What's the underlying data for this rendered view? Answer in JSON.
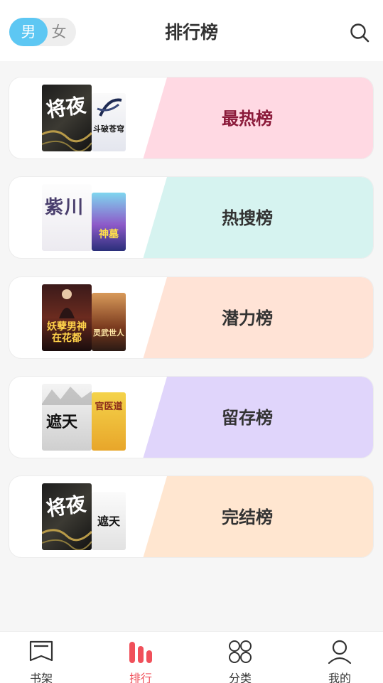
{
  "header": {
    "title": "排行榜",
    "gender_male": "男",
    "gender_female": "女",
    "selected_gender": "男"
  },
  "rankings": [
    {
      "label": "最热榜",
      "accent": "#ffd9e3",
      "text_color": "#8b1a3a",
      "covers": [
        "将夜",
        "斗破苍穹"
      ]
    },
    {
      "label": "热搜榜",
      "accent": "#d6f3f0",
      "text_color": "#333333",
      "covers": [
        "紫川",
        "神墓"
      ]
    },
    {
      "label": "潜力榜",
      "accent": "#ffe3d6",
      "text_color": "#333333",
      "covers": [
        "妖孽男神在花都",
        "灵武世人"
      ]
    },
    {
      "label": "留存榜",
      "accent": "#e0d5fb",
      "text_color": "#333333",
      "covers": [
        "遮天",
        "官医道"
      ]
    },
    {
      "label": "完结榜",
      "accent": "#ffe6d0",
      "text_color": "#333333",
      "covers": [
        "将夜",
        "遮天"
      ]
    }
  ],
  "tabbar": {
    "items": [
      {
        "label": "书架",
        "icon": "bookshelf-icon"
      },
      {
        "label": "排行",
        "icon": "ranking-icon"
      },
      {
        "label": "分类",
        "icon": "category-icon"
      },
      {
        "label": "我的",
        "icon": "profile-icon"
      }
    ],
    "active": "排行",
    "active_color": "#f0505a"
  }
}
